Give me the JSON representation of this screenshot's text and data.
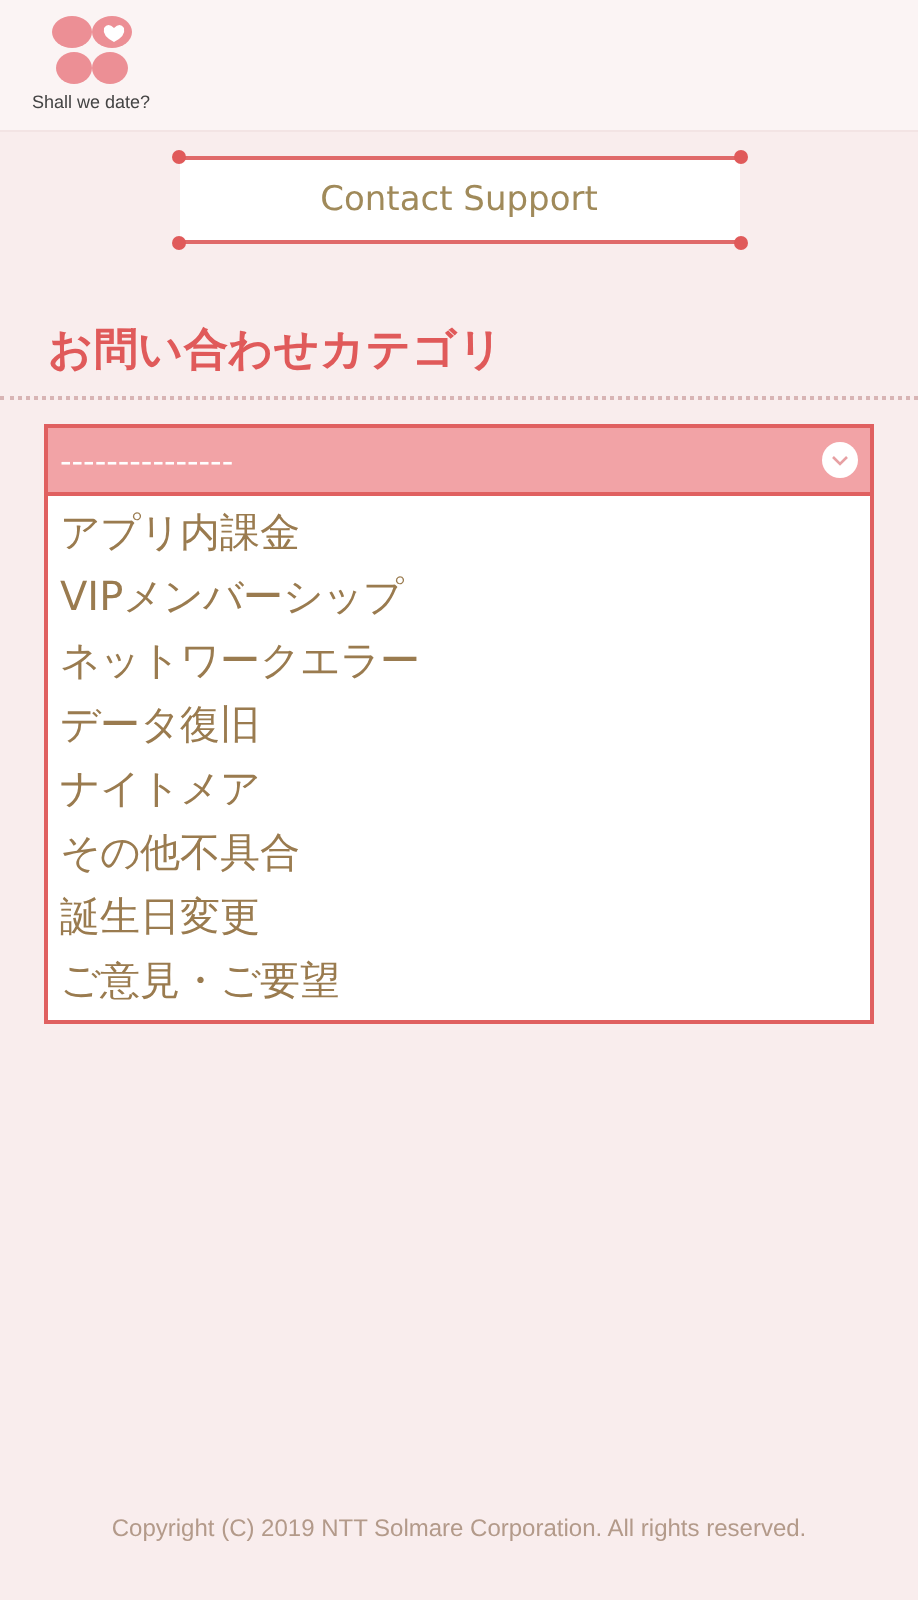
{
  "logo": {
    "text": "Shall we date?"
  },
  "banner": {
    "title": "Contact Support"
  },
  "category": {
    "heading": "お問い合わせカテゴリ",
    "select": {
      "value": "---------------",
      "expanded": true,
      "options": [
        {
          "label": "アプリ内課金",
          "selected": false
        },
        {
          "label": "VIPメンバーシップ",
          "selected": false
        },
        {
          "label": "ネットワークエラー",
          "selected": false
        },
        {
          "label": "データ復旧",
          "selected": false
        },
        {
          "label": "ナイトメア",
          "selected": false
        },
        {
          "label": "その他不具合",
          "selected": false
        },
        {
          "label": "誕生日変更",
          "selected": false
        },
        {
          "label": "ご意見・ご要望",
          "selected": false
        }
      ]
    }
  },
  "footer": {
    "copyright": "Copyright (C) 2019 NTT Solmare Corporation. All rights reserved."
  }
}
